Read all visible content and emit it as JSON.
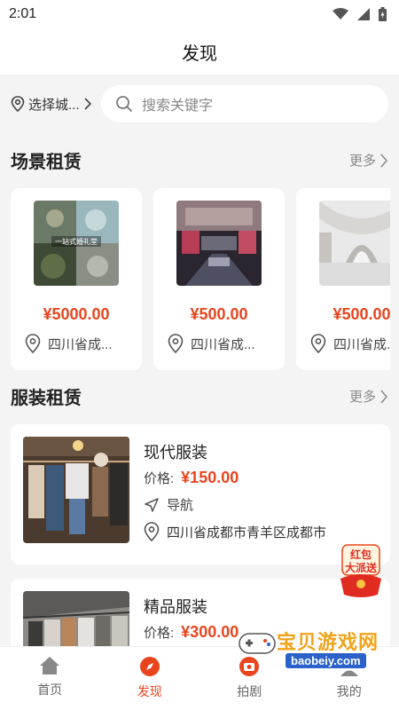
{
  "status_bar": {
    "time": "2:01"
  },
  "header": {
    "title": "发现"
  },
  "search": {
    "city_label": "选择城...",
    "placeholder": "搜索关键字"
  },
  "venue_section": {
    "title": "场景租赁",
    "more_label": "更多",
    "items": [
      {
        "price": "¥5000.00",
        "location": "四川省成...",
        "image_caption": "一站式婚礼堂"
      },
      {
        "price": "¥500.00",
        "location": "四川省成..."
      },
      {
        "price": "¥500.00",
        "location": "四川省成..."
      }
    ]
  },
  "clothing_section": {
    "title": "服装租赁",
    "more_label": "更多",
    "items": [
      {
        "name": "现代服装",
        "price_label": "价格:",
        "price": "¥150.00",
        "nav_label": "导航",
        "address": "四川省成都市青羊区成都市"
      },
      {
        "name": "精品服装",
        "price_label": "价格:",
        "price": "¥300.00"
      }
    ]
  },
  "red_packet": {
    "line1": "红包",
    "line2": "大派送"
  },
  "tab_bar": {
    "tabs": [
      {
        "label": "首页",
        "active": false
      },
      {
        "label": "发现",
        "active": true
      },
      {
        "label": "拍剧",
        "active": false
      },
      {
        "label": "我的",
        "active": false
      }
    ]
  },
  "watermark": {
    "text": "宝贝游戏网",
    "url": "baobeiy.com"
  },
  "colors": {
    "accent": "#e8451e",
    "background": "#f4f4f4",
    "card": "#ffffff"
  }
}
